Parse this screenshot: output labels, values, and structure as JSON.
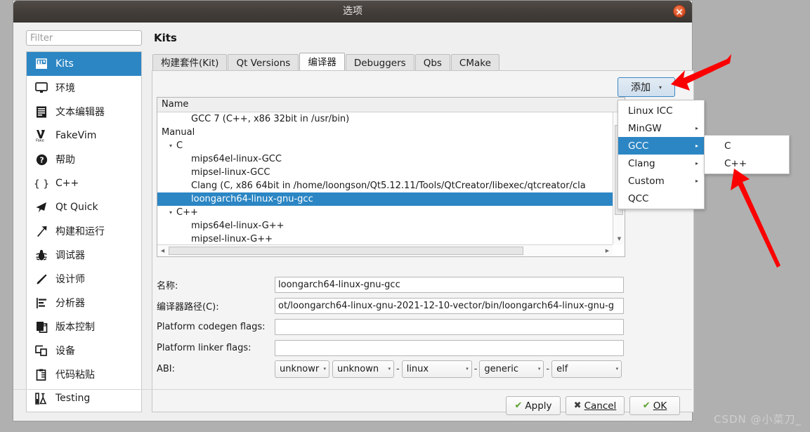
{
  "window": {
    "title": "选项",
    "close_label": "×"
  },
  "search": {
    "placeholder": "Filter",
    "value": ""
  },
  "sidebar": {
    "items": [
      {
        "label": "Kits",
        "icon": "kits-icon",
        "selected": true
      },
      {
        "label": "环境",
        "icon": "monitor-icon",
        "selected": false
      },
      {
        "label": "文本编辑器",
        "icon": "text-editor-icon",
        "selected": false
      },
      {
        "label": "FakeVim",
        "icon": "fakevim-icon",
        "selected": false
      },
      {
        "label": "帮助",
        "icon": "help-icon",
        "selected": false
      },
      {
        "label": "C++",
        "icon": "braces-icon",
        "selected": false
      },
      {
        "label": "Qt Quick",
        "icon": "paper-plane-icon",
        "selected": false
      },
      {
        "label": "构建和运行",
        "icon": "hammer-icon",
        "selected": false
      },
      {
        "label": "调试器",
        "icon": "bug-icon",
        "selected": false
      },
      {
        "label": "设计师",
        "icon": "pencil-icon",
        "selected": false
      },
      {
        "label": "分析器",
        "icon": "analyzer-icon",
        "selected": false
      },
      {
        "label": "版本控制",
        "icon": "version-control-icon",
        "selected": false
      },
      {
        "label": "设备",
        "icon": "devices-icon",
        "selected": false
      },
      {
        "label": "代码粘贴",
        "icon": "clipboard-icon",
        "selected": false
      },
      {
        "label": "Testing",
        "icon": "testing-icon",
        "selected": false
      }
    ]
  },
  "pane": {
    "title": "Kits",
    "tabs": [
      {
        "label": "构建套件(Kit)",
        "active": false
      },
      {
        "label": "Qt Versions",
        "active": false
      },
      {
        "label": "编译器",
        "active": true
      },
      {
        "label": "Debuggers",
        "active": false
      },
      {
        "label": "Qbs",
        "active": false
      },
      {
        "label": "CMake",
        "active": false
      }
    ]
  },
  "tree": {
    "header": "Name",
    "rows": [
      {
        "indent": 3,
        "twisty": "",
        "label": "GCC 7 (C++, x86 32bit in /usr/bin)",
        "selected": false
      },
      {
        "indent": 1,
        "twisty": "▾",
        "label": "Manual",
        "selected": false
      },
      {
        "indent": 2,
        "twisty": "▾",
        "label": "C",
        "selected": false
      },
      {
        "indent": 3,
        "twisty": "",
        "label": "mips64el-linux-GCC",
        "selected": false
      },
      {
        "indent": 3,
        "twisty": "",
        "label": "mipsel-linux-GCC",
        "selected": false
      },
      {
        "indent": 3,
        "twisty": "",
        "label": "Clang (C, x86 64bit in /home/loongson/Qt5.12.11/Tools/QtCreator/libexec/qtcreator/cla",
        "selected": false
      },
      {
        "indent": 3,
        "twisty": "",
        "label": "loongarch64-linux-gnu-gcc",
        "selected": true
      },
      {
        "indent": 2,
        "twisty": "▾",
        "label": "C++",
        "selected": false
      },
      {
        "indent": 3,
        "twisty": "",
        "label": "mips64el-linux-G++",
        "selected": false
      },
      {
        "indent": 3,
        "twisty": "",
        "label": "mipsel-linux-G++",
        "selected": false
      }
    ]
  },
  "add": {
    "label": "添加",
    "arrow": "▾",
    "menu_items": [
      {
        "label": "Linux ICC",
        "submenu": false,
        "highlighted": false
      },
      {
        "label": "MinGW",
        "submenu": true,
        "highlighted": false
      },
      {
        "label": "GCC",
        "submenu": true,
        "highlighted": true
      },
      {
        "label": "Clang",
        "submenu": true,
        "highlighted": false
      },
      {
        "label": "Custom",
        "submenu": true,
        "highlighted": false
      },
      {
        "label": "QCC",
        "submenu": false,
        "highlighted": false
      }
    ],
    "submenu_items": [
      {
        "label": "C"
      },
      {
        "label": "C++"
      }
    ],
    "submenu_arrow": "▸"
  },
  "form": {
    "name_label": "名称:",
    "name_value": "loongarch64-linux-gnu-gcc",
    "path_label": "编译器路径(C):",
    "path_value": "ot/loongarch64-linux-gnu-2021-12-10-vector/bin/loongarch64-linux-gnu-g",
    "codegen_label": "Platform codegen flags:",
    "codegen_value": "",
    "linker_label": "Platform linker flags:",
    "linker_value": "",
    "abi_label": "ABI:",
    "abi_values": [
      "unknowr",
      "unknown",
      "linux",
      "generic",
      "elf"
    ],
    "abi_separator": "-",
    "combo_arrow": "▾"
  },
  "footer": {
    "apply": "Apply",
    "cancel": "Cancel",
    "ok": "OK",
    "check_glyph": "✔",
    "x_glyph": "✖"
  },
  "watermark": "CSDN @小菜刀_",
  "colors": {
    "accent": "#2c86c4",
    "titlebar": "#443f3b",
    "desktop": "#b0b0b0",
    "dialog": "#efefef",
    "arrow_red": "#fb0000"
  }
}
